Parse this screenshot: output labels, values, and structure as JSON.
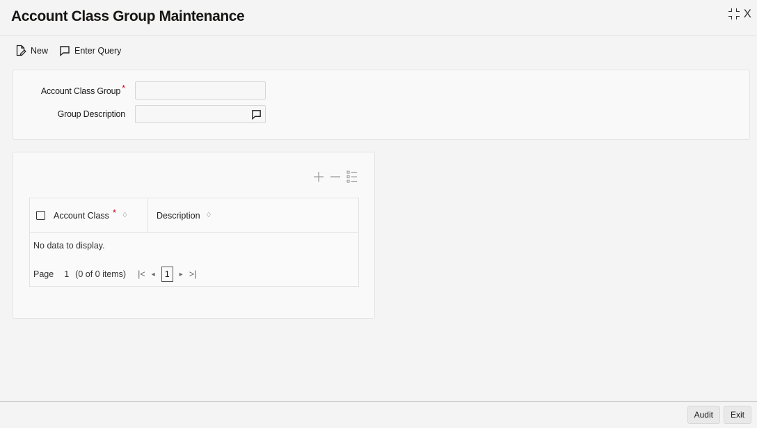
{
  "window": {
    "title": "Account Class Group Maintenance",
    "close_label": "X"
  },
  "toolbar": {
    "new_label": "New",
    "new_icon": "new-document-icon",
    "enter_query_label": "Enter Query",
    "enter_query_icon": "query-icon"
  },
  "header": {
    "account_class_group": {
      "label": "Account Class Group",
      "required_mark": "*",
      "value": ""
    },
    "group_description": {
      "label": "Group Description",
      "value": "",
      "button_icon": "comment-icon"
    }
  },
  "grid": {
    "tools": [
      "add-row-icon",
      "delete-row-icon",
      "single-view-icon"
    ],
    "columns": [
      {
        "label": "Account Class",
        "required_mark": "*",
        "sort_icon": "sort-icon"
      },
      {
        "label": "Description",
        "sort_icon": "sort-icon"
      }
    ],
    "empty_message": "No data to display.",
    "pagination": {
      "page_label": "Page",
      "page_number": "1",
      "items_text": "(0 of 0 items)",
      "first_glyph": "|<",
      "prev_glyph": "◂",
      "current_page": "1",
      "next_glyph": "▸",
      "last_glyph": ">|"
    }
  },
  "footer": {
    "audit_label": "Audit",
    "exit_label": "Exit"
  },
  "colors": {
    "required": "#d0021b",
    "text": "#1b1b1b",
    "border": "#e2e2e2"
  }
}
